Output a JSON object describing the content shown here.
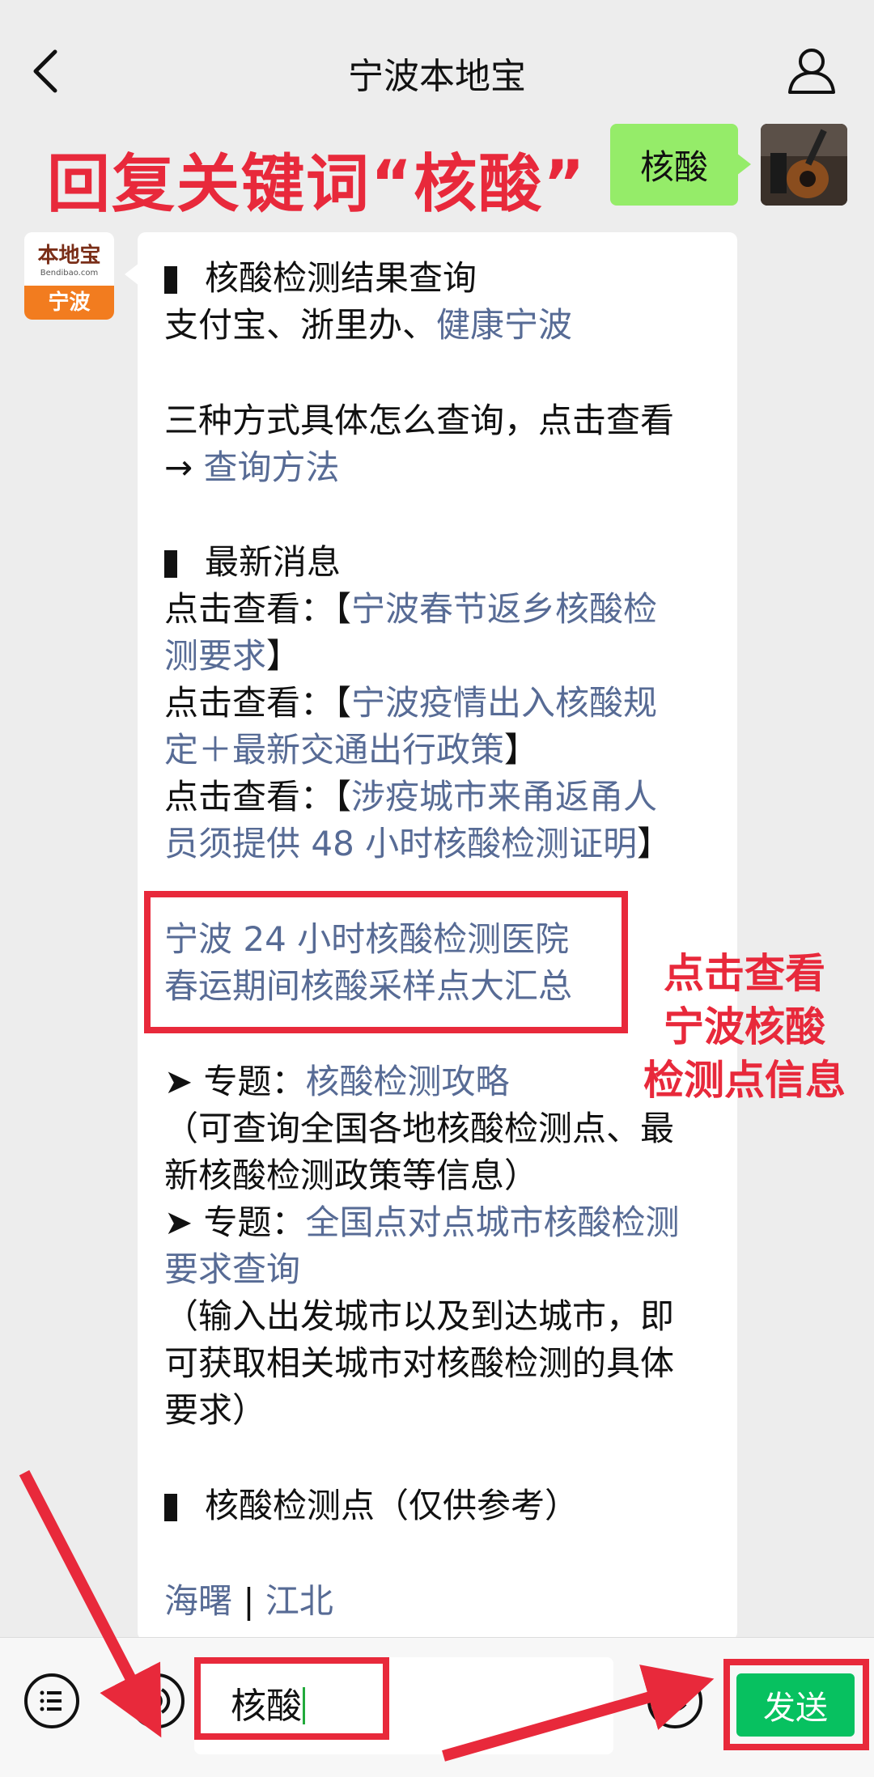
{
  "header": {
    "title": "宁波本地宝"
  },
  "annotation_keyword": "回复关键词“核酸”",
  "my_message": "核酸",
  "bot_avatar": {
    "logo": "本地宝",
    "logo_sub": "Bendibao.com",
    "city": "宁波"
  },
  "reply": {
    "section1_title": "核酸检测结果查询",
    "section1_platforms": "支付宝、浙里办、",
    "section1_link": "健康宁波",
    "methods_text": "三种方式具体怎么查询，点击查看",
    "methods_arrow": "→ ",
    "methods_link": "查询方法",
    "section2_title": "最新消息",
    "click_prefix": "点击查看：",
    "bracket_open": "【",
    "bracket_close": "】",
    "news1_line1": "宁波春节返乡核酸检",
    "news1_line2": "测要求",
    "news2_line1": "宁波疫情出入核酸规",
    "news2_line2": "定＋最新交通出行政策",
    "news3_line1": "涉疫城市来甬返甬人",
    "news3_line2": "员须提供 48 小时核酸检测证明",
    "highlight1": "宁波 24 小时核酸检测医院",
    "highlight2": "春运期间核酸采样点大汇总",
    "topic_prefix": "➤ 专题：",
    "topic1_link": "核酸检测攻略",
    "topic1_desc1": "（可查询全国各地核酸检测点、最",
    "topic1_desc2": "新核酸检测政策等信息）",
    "topic2_link1": "全国点对点城市核酸检测",
    "topic2_link2": "要求查询",
    "topic2_desc1": "（输入出发城市以及到达城市，即",
    "topic2_desc2": "可获取相关城市对核酸检测的具体",
    "topic2_desc3": "要求）",
    "section3_title": "核酸检测点（仅供参考）",
    "district1": "海曙",
    "district_sep": " | ",
    "district2": "江北"
  },
  "side_annotation": {
    "line1": "点击查看",
    "line2": "宁波核酸",
    "line3": "检测点信息"
  },
  "input_bar": {
    "input_value": "核酸",
    "send_label": "发送"
  },
  "colors": {
    "annotation_red": "#e8293b",
    "link_blue": "#576b95",
    "wechat_green": "#07c160",
    "bubble_green": "#95ec69"
  },
  "icons": [
    "back-arrow-icon",
    "user-icon",
    "menu-list-icon",
    "voice-icon",
    "emoji-icon"
  ]
}
